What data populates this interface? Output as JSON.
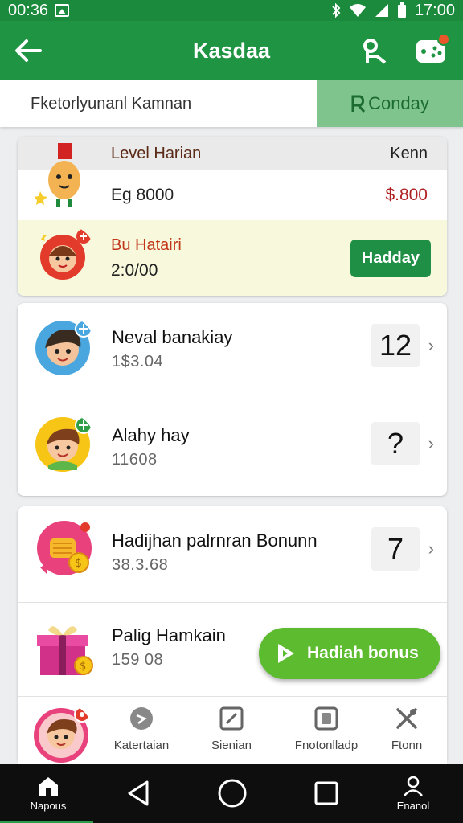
{
  "status_bar": {
    "time_left": "00:36",
    "time_right": "17:00"
  },
  "app_bar": {
    "title": "Kasdaa",
    "back_icon": "arrow-left-icon",
    "action_1_icon": "key-person-icon",
    "action_2_icon": "game-controller-icon"
  },
  "sub_bar": {
    "search_text": "Fketorlyunanl Kamnan",
    "filter_label": "Conday"
  },
  "level_card": {
    "header_title": "Level Harian",
    "header_right": "Kenn",
    "row1_label": "Eg 8000",
    "row1_amount": "$.800",
    "row2_title": "Bu Hatairi",
    "row2_value": "2:0/00",
    "row2_button": "Hadday"
  },
  "list_items": [
    {
      "name": "Neval banakiay",
      "sub": "1$3.04",
      "count": "12"
    },
    {
      "name": "Alahy hay",
      "sub": "11608",
      "count": "?"
    },
    {
      "name": "Hadijhan palrnran Bonunn",
      "sub": "38.3.68",
      "count": "7"
    },
    {
      "name": "Palig Hamkain",
      "sub": "159 08"
    }
  ],
  "fab_label": "Hadiah bonus",
  "bottom_tabs": [
    {
      "label": "Katertaian"
    },
    {
      "label": "Sienian"
    },
    {
      "label": "Fnotonlladp"
    },
    {
      "label": "Ftonn"
    }
  ],
  "nav_bar": {
    "home_label": "Napous",
    "profile_label": "Enanol"
  },
  "colors": {
    "primary": "#1f9443",
    "accent": "#5cbb2e",
    "price_red": "#b02323"
  }
}
